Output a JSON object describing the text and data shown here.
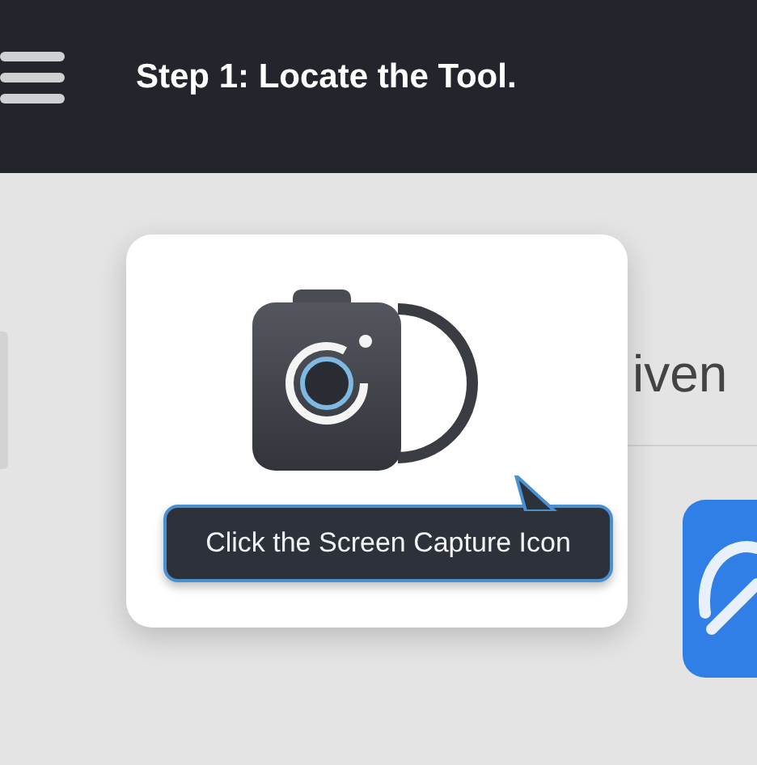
{
  "header": {
    "title": "Step 1: Locate the Tool."
  },
  "background": {
    "heading_fragment": "iven"
  },
  "callout": {
    "tooltip": "Click the Screen Capture Icon"
  }
}
